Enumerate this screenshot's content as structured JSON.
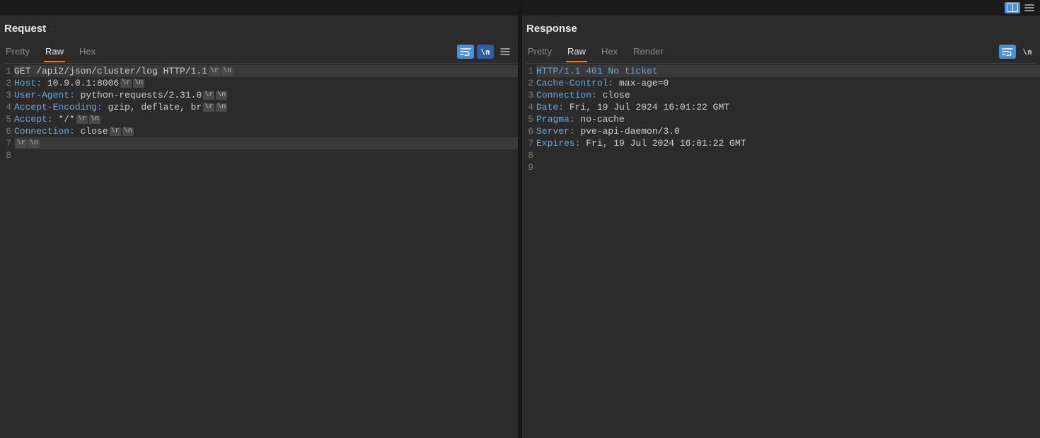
{
  "left": {
    "title": "Request",
    "tabs": [
      "Pretty",
      "Raw",
      "Hex"
    ],
    "activeTab": 1,
    "tools": {
      "wrap": "wrap-icon",
      "literals": "\\n",
      "menu": "hamburger-icon"
    },
    "lines": [
      {
        "num": 1,
        "hl": true,
        "segs": [
          {
            "t": "GET /api2/json/cluster/log HTTP/1.1",
            "c": "txt"
          }
        ],
        "crlf": true
      },
      {
        "num": 2,
        "hl": false,
        "segs": [
          {
            "t": "Host:",
            "c": "hdr"
          },
          {
            "t": " 10.9.0.1:8006",
            "c": "txt"
          }
        ],
        "crlf": true
      },
      {
        "num": 3,
        "hl": false,
        "segs": [
          {
            "t": "User-Agent:",
            "c": "hdr"
          },
          {
            "t": " python-requests/2.31.0",
            "c": "txt"
          }
        ],
        "crlf": true
      },
      {
        "num": 4,
        "hl": false,
        "segs": [
          {
            "t": "Accept-Encoding:",
            "c": "hdr"
          },
          {
            "t": " gzip, deflate, br",
            "c": "txt"
          }
        ],
        "crlf": true
      },
      {
        "num": 5,
        "hl": false,
        "segs": [
          {
            "t": "Accept:",
            "c": "hdr"
          },
          {
            "t": " */*",
            "c": "txt"
          }
        ],
        "crlf": true
      },
      {
        "num": 6,
        "hl": false,
        "segs": [
          {
            "t": "Connection:",
            "c": "hdr"
          },
          {
            "t": " close",
            "c": "txt"
          }
        ],
        "crlf": true
      },
      {
        "num": 7,
        "hl": true,
        "segs": [],
        "crlf": true
      },
      {
        "num": 8,
        "hl": false,
        "segs": [],
        "crlf": false
      }
    ]
  },
  "right": {
    "title": "Response",
    "tabs": [
      "Pretty",
      "Raw",
      "Hex",
      "Render"
    ],
    "activeTab": 1,
    "tools": {
      "wrap": "wrap-icon",
      "literals": "\\n"
    },
    "topButtons": {
      "splitV": "split-vertical-icon",
      "menu": "menu-lines-icon"
    },
    "lines": [
      {
        "num": 1,
        "hl": true,
        "segs": [
          {
            "t": "HTTP/1.1 401 No ticket",
            "c": "hdr"
          }
        ],
        "crlf": false
      },
      {
        "num": 2,
        "hl": false,
        "segs": [
          {
            "t": "Cache-Control:",
            "c": "hdr"
          },
          {
            "t": " max-age=0",
            "c": "txt"
          }
        ],
        "crlf": false
      },
      {
        "num": 3,
        "hl": false,
        "segs": [
          {
            "t": "Connection:",
            "c": "hdr"
          },
          {
            "t": " close",
            "c": "txt"
          }
        ],
        "crlf": false
      },
      {
        "num": 4,
        "hl": false,
        "segs": [
          {
            "t": "Date:",
            "c": "hdr"
          },
          {
            "t": " Fri, 19 Jul 2024 16:01:22 GMT",
            "c": "txt"
          }
        ],
        "crlf": false
      },
      {
        "num": 5,
        "hl": false,
        "segs": [
          {
            "t": "Pragma:",
            "c": "hdr"
          },
          {
            "t": " no-cache",
            "c": "txt"
          }
        ],
        "crlf": false
      },
      {
        "num": 6,
        "hl": false,
        "segs": [
          {
            "t": "Server:",
            "c": "hdr"
          },
          {
            "t": " pve-api-daemon/3.0",
            "c": "txt"
          }
        ],
        "crlf": false
      },
      {
        "num": 7,
        "hl": false,
        "segs": [
          {
            "t": "Expires:",
            "c": "hdr"
          },
          {
            "t": " Fri, 19 Jul 2024 16:01:22 GMT",
            "c": "txt"
          }
        ],
        "crlf": false
      },
      {
        "num": 8,
        "hl": false,
        "segs": [],
        "crlf": false
      },
      {
        "num": 9,
        "hl": false,
        "segs": [],
        "crlf": false
      }
    ]
  },
  "crlf_tokens": {
    "r": "\\r",
    "n": "\\n"
  }
}
